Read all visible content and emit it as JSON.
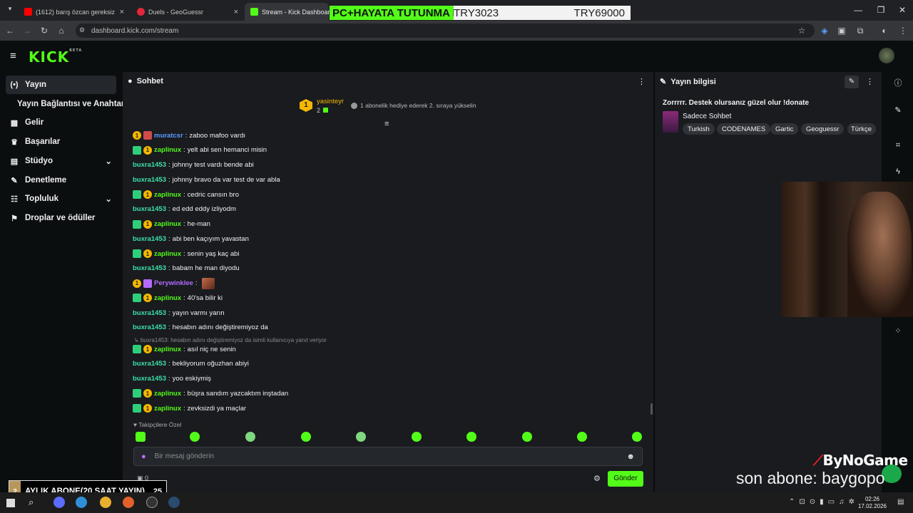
{
  "browser": {
    "tabs": [
      {
        "title": "(1612) barış özcan gereksiz san",
        "color": "#ff0000"
      },
      {
        "title": "Duels - GeoGuessr",
        "color": "#e3263b"
      },
      {
        "title": "Stream - Kick Dashboard",
        "color": "#53fc18"
      }
    ],
    "url": "dashboard.kick.com/stream"
  },
  "overlay": {
    "goal_text": "PC+HAYATA TUTUNMA BARY",
    "current": "TRY3023",
    "target": "TRY69000"
  },
  "kick": {
    "logo": "KICK",
    "logo_sup": "BETA"
  },
  "sidebar": {
    "items": [
      {
        "label": "Yayın",
        "icon": "stream-icon"
      },
      {
        "label": "Yayın Bağlantısı ve Anahtarı",
        "icon": ""
      },
      {
        "label": "Gelir",
        "icon": "revenue-icon"
      },
      {
        "label": "Başarılar",
        "icon": "trophy-icon"
      },
      {
        "label": "Stüdyo",
        "icon": "studio-icon"
      },
      {
        "label": "Denetleme",
        "icon": "wrench-icon"
      },
      {
        "label": "Topluluk",
        "icon": "community-icon"
      },
      {
        "label": "Droplar ve ödüller",
        "icon": "drops-icon"
      }
    ]
  },
  "chat": {
    "title": "Sohbet",
    "pinned_user": "yasinteyr",
    "pinned_count": "2",
    "gift_text": "1 abonelik hediye ederek 2. sıraya yükselin",
    "messages": [
      {
        "user": "muratcsr",
        "text": "zaboo mafoo vardı",
        "color": "#5b9bff"
      },
      {
        "user": "zaplinux",
        "text": "yelt abi sen hemanci misin",
        "color": "#53fc18"
      },
      {
        "user": "buxra1453",
        "text": "johnny test vardı bende abi",
        "color": "#3de0a8"
      },
      {
        "user": "buxra1453",
        "text": "johnny bravo da var test de var abla",
        "color": "#3de0a8"
      },
      {
        "user": "zaplinux",
        "text": "cedric cansın bro",
        "color": "#53fc18"
      },
      {
        "user": "buxra1453",
        "text": "ed edd eddy izliyodm",
        "color": "#3de0a8"
      },
      {
        "user": "zaplinux",
        "text": "he-man",
        "color": "#53fc18"
      },
      {
        "user": "buxra1453",
        "text": "abi ben kaçıyım yavastan",
        "color": "#3de0a8"
      },
      {
        "user": "zaplinux",
        "text": "senin yaş kaç abi",
        "color": "#53fc18"
      },
      {
        "user": "buxra1453",
        "text": "babam he man diyodu",
        "color": "#3de0a8"
      },
      {
        "user": "Perywinklee",
        "text": "",
        "color": "#b36bff"
      },
      {
        "user": "zaplinux",
        "text": "40'sa bilir ki",
        "color": "#53fc18"
      },
      {
        "user": "buxra1453",
        "text": "yayın varmı yarın",
        "color": "#3de0a8"
      },
      {
        "user": "buxra1453",
        "text": "hesabın adını değiştiremiyoz da",
        "color": "#3de0a8"
      }
    ],
    "reply_context": "buxra1453: hesabın adını değiştiremiyoz da isimli kullanıcıya yanıt veriyor",
    "messages2": [
      {
        "user": "zaplinux",
        "text": "asıl niç ne senin",
        "color": "#53fc18"
      },
      {
        "user": "buxra1453",
        "text": "bekliyorum oğuzhan abiyi",
        "color": "#3de0a8"
      },
      {
        "user": "buxra1453",
        "text": "yoo eskiymiş",
        "color": "#3de0a8"
      },
      {
        "user": "zaplinux",
        "text": "büşra sandım yazcaktım inştadan",
        "color": "#53fc18"
      },
      {
        "user": "zaplinux",
        "text": "zevksizdi ya maçlar",
        "color": "#53fc18"
      }
    ],
    "followers_only": "Takipçilere Özel",
    "input_placeholder": "Bir mesaj gönderin",
    "send_label": "Gönder",
    "points": "0"
  },
  "stream_info": {
    "title": "Yayın bilgisi",
    "stream_title": "Zorrrrr. Destek olursanız güzel olur !donate",
    "category": "Sadece Sohbet",
    "tags": [
      "Turkish",
      "CODENAMES",
      "Gartic",
      "Geoguessr",
      "Türkçe"
    ]
  },
  "stream_overlay": {
    "brand": "ByNoGame",
    "last_sub": "son abone: baygopo",
    "monthly_sub_label": "AYLIK ABONE(20 SAAT YAYIN)",
    "monthly_sub_left": "2",
    "monthly_sub_right": "25"
  },
  "taskbar": {
    "time": "02:26",
    "date": "17.02.2026"
  }
}
